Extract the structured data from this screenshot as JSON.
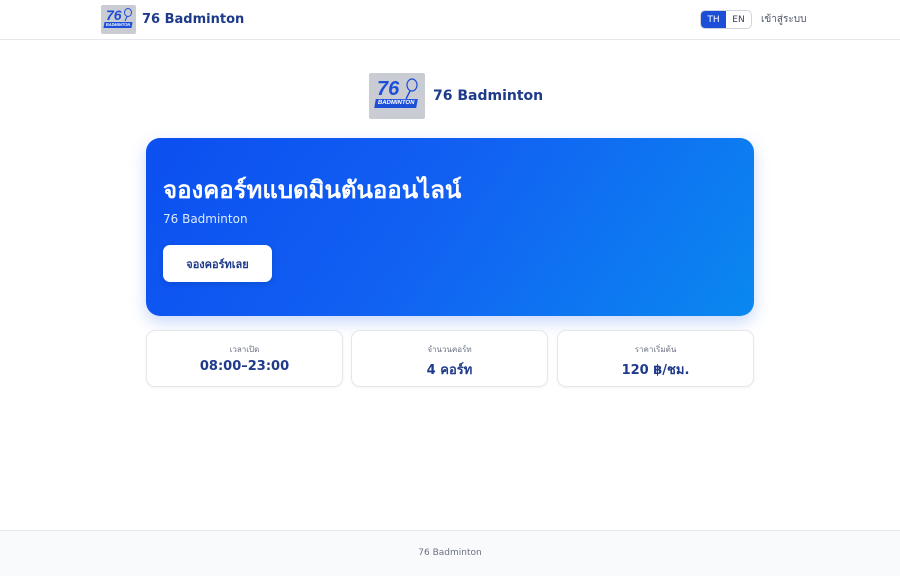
{
  "header": {
    "brand_name": "76 Badminton",
    "lang": {
      "th": "TH",
      "en": "EN",
      "active": "TH"
    },
    "login_label": "เข้าสู่ระบบ"
  },
  "logo": {
    "number": "76",
    "banner": "BADMINTON"
  },
  "center_brand": {
    "name": "76 Badminton"
  },
  "hero": {
    "title": "จองคอร์ทแบดมินตันออนไลน์",
    "subtitle": "76 Badminton",
    "cta_label": "จองคอร์ทเลย"
  },
  "info_cards": [
    {
      "label": "เวลาเปิด",
      "value": "08:00–23:00"
    },
    {
      "label": "จำนวนคอร์ท",
      "value": "4 คอร์ท"
    },
    {
      "label": "ราคาเริ่มต้น",
      "value": "120 ฿/ชม."
    }
  ],
  "footer": {
    "text": "76 Badminton"
  },
  "colors": {
    "brand": "#1e3a8a",
    "accent": "#1d4ed8",
    "hero_gradient_start": "#0b4ff0",
    "hero_gradient_end": "#0a88f0"
  }
}
